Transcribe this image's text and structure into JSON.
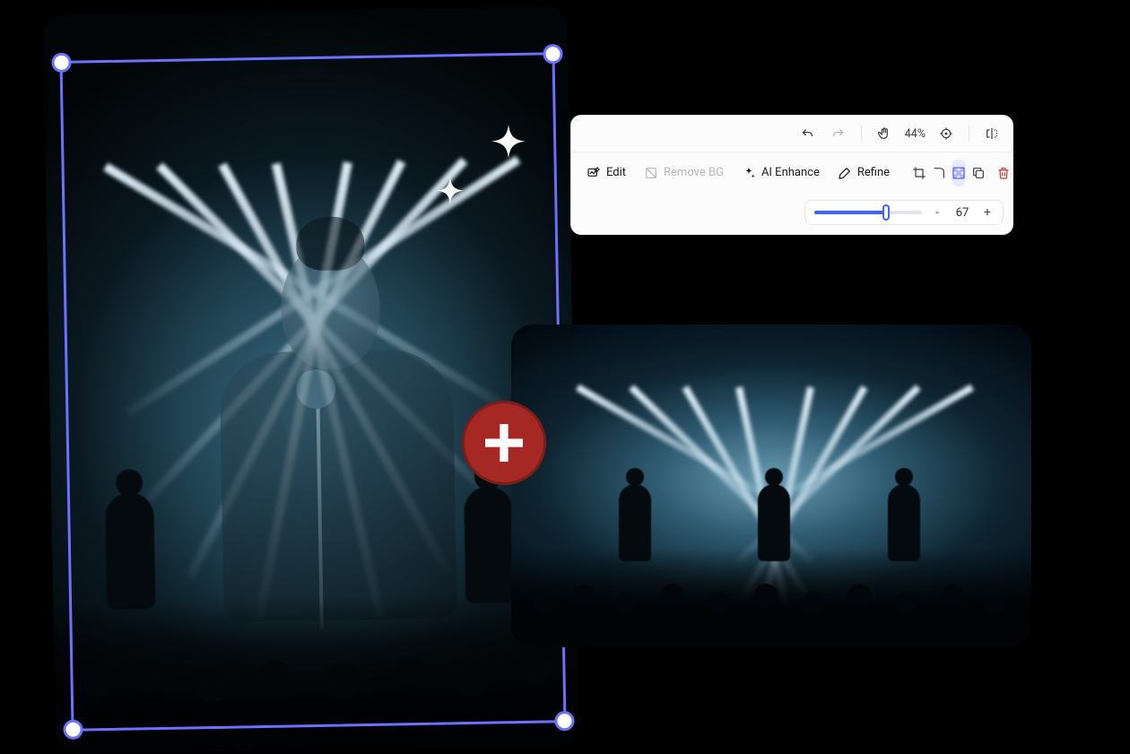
{
  "toolbar": {
    "top": {
      "undo": "undo",
      "redo": "redo",
      "pan": "pan",
      "zoom_level": "44%",
      "centerview": "center",
      "flip": "flip"
    },
    "tools": {
      "edit": "Edit",
      "remove_bg": "Remove BG",
      "ai_enhance": "AI Enhance",
      "refine": "Refine"
    },
    "slider": {
      "minus": "-",
      "plus": "+",
      "value": "67",
      "percent": 67
    }
  },
  "badges": {
    "plus": "add"
  },
  "selection": {
    "selected": true
  },
  "colors": {
    "selection": "#6a72ff",
    "accent": "#3e63ff",
    "danger": "#e0352b",
    "plus_badge": "#a52824"
  }
}
